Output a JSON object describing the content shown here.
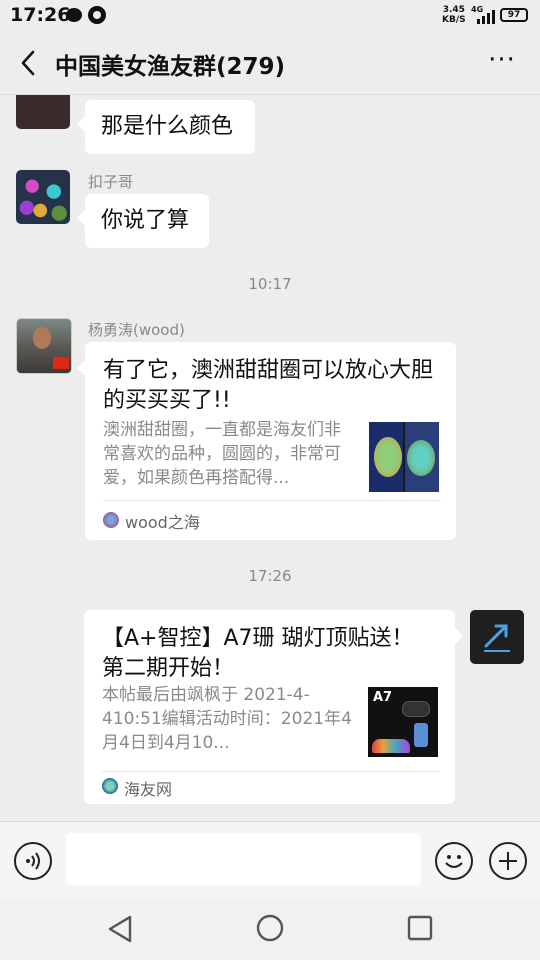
{
  "status_bar": {
    "time": "17:26",
    "speed_value": "3.45",
    "speed_unit": "KB/S",
    "network": "4G",
    "battery": "97",
    "icons": [
      "message-icon",
      "app-icon",
      "signal-icon",
      "battery-icon"
    ]
  },
  "header": {
    "title": "中国美女渔友群(279)",
    "more": "···"
  },
  "messages": [
    {
      "type": "text",
      "text": "那是什么颜色"
    },
    {
      "type": "text",
      "sender": "扣子哥",
      "text": "你说了算"
    },
    {
      "type": "timestamp",
      "text": "10:17"
    },
    {
      "type": "card",
      "sender": "杨勇涛(wood)",
      "title": "有了它，澳洲甜甜圈可以放心大胆的买买买了!!",
      "desc": "澳洲甜甜圈，一直都是海友们非常喜欢的品种，圆圆的，非常可爱，如果颜色再搭配得...",
      "source": "wood之海"
    },
    {
      "type": "timestamp",
      "text": "17:26"
    },
    {
      "type": "card",
      "title": "【A+智控】A7珊 瑚灯顶贴送！第二期开始！",
      "desc": "本帖最后由飒枫于 2021-4-410:51编辑活动时间：2021年4月4日到4月10...",
      "thumb_label": "A7",
      "source": "海友网"
    }
  ],
  "input_bar": {
    "voice_icon": "voice-icon",
    "emoji_icon": "emoji-icon",
    "add_icon": "plus-icon"
  },
  "colors": {
    "background": "#ededed",
    "bubble": "#ffffff",
    "muted_text": "#8a8a8a"
  }
}
